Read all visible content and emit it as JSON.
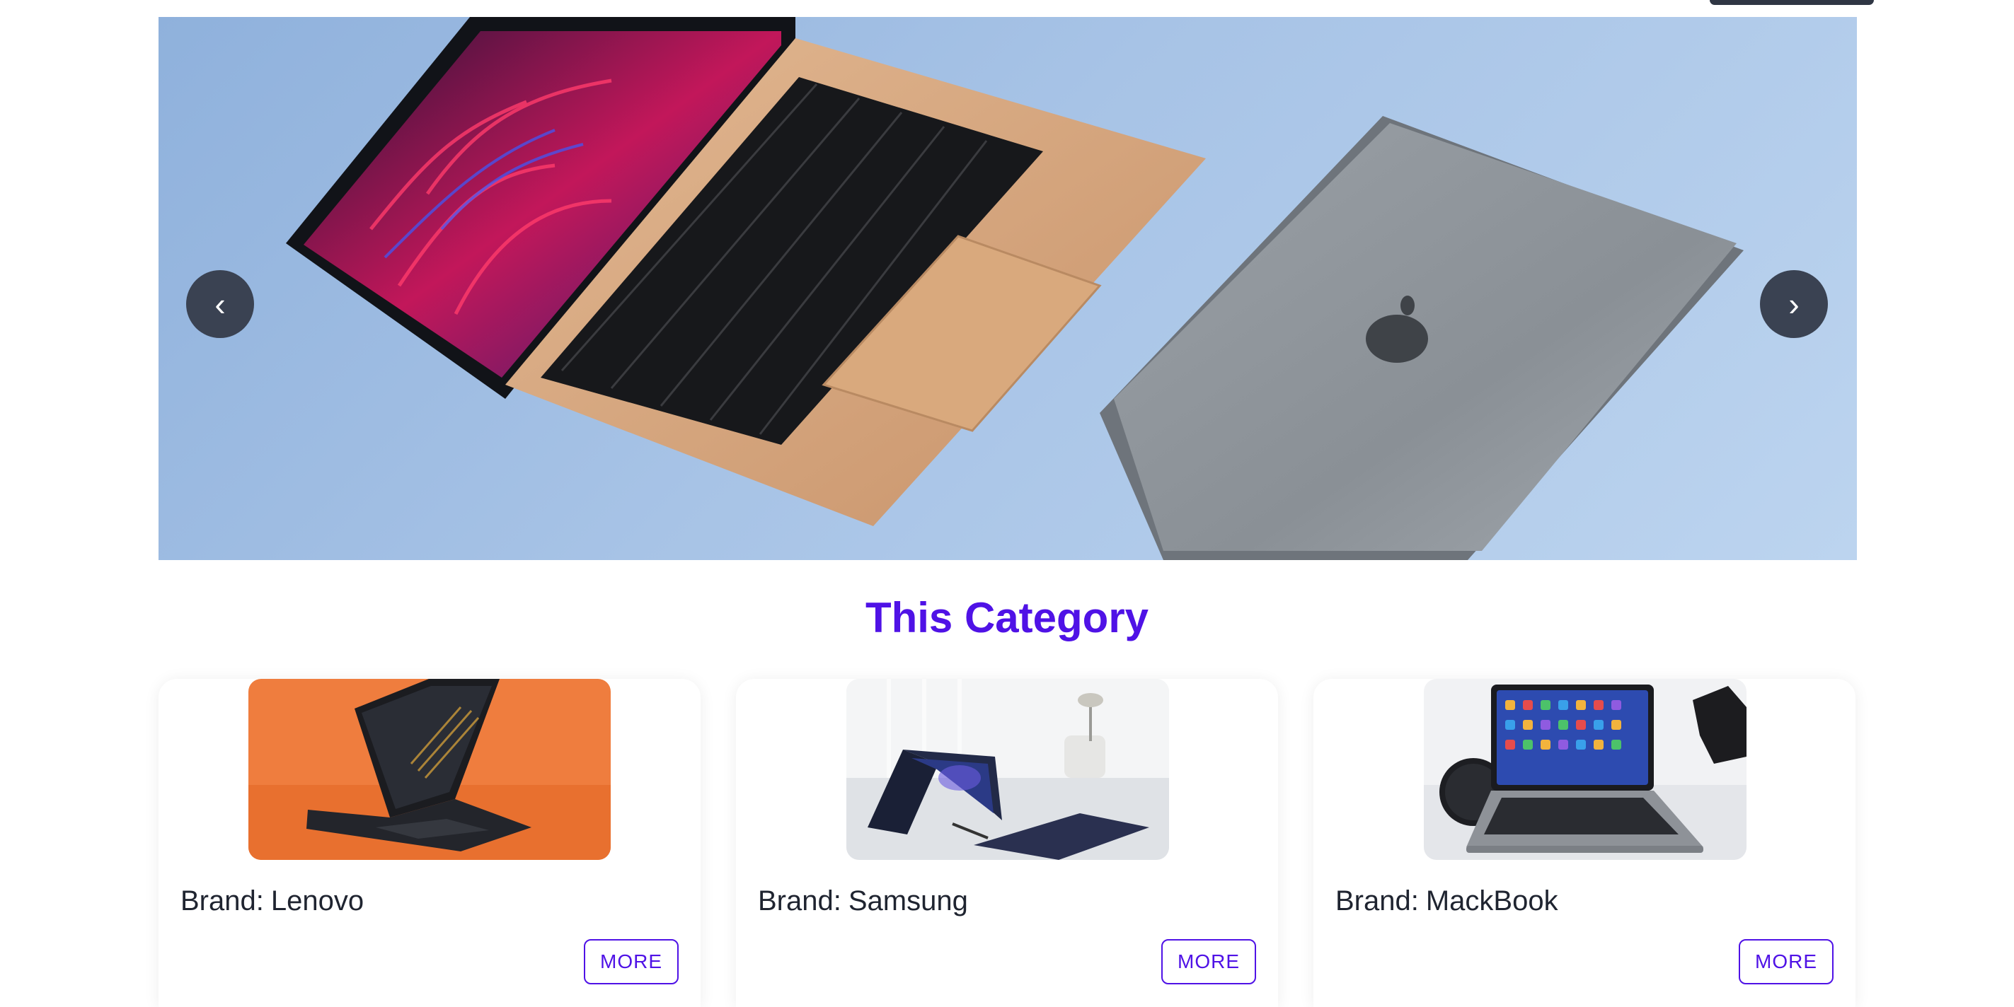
{
  "carousel": {
    "prev_icon": "‹",
    "next_icon": "›",
    "slide": "laptops-slide"
  },
  "section": {
    "title": "This Category"
  },
  "cards": [
    {
      "label": "Brand:",
      "name": "Lenovo",
      "button": "MORE",
      "image": "lenovo-laptop-image"
    },
    {
      "label": "Brand:",
      "name": "Samsung",
      "button": "MORE",
      "image": "samsung-laptop-image"
    },
    {
      "label": "Brand:",
      "name": "MackBook",
      "button": "MORE",
      "image": "macbook-laptop-image"
    }
  ],
  "colors": {
    "accent": "#4f12e6",
    "nav_button": "#3a4252",
    "text": "#1f2430"
  }
}
